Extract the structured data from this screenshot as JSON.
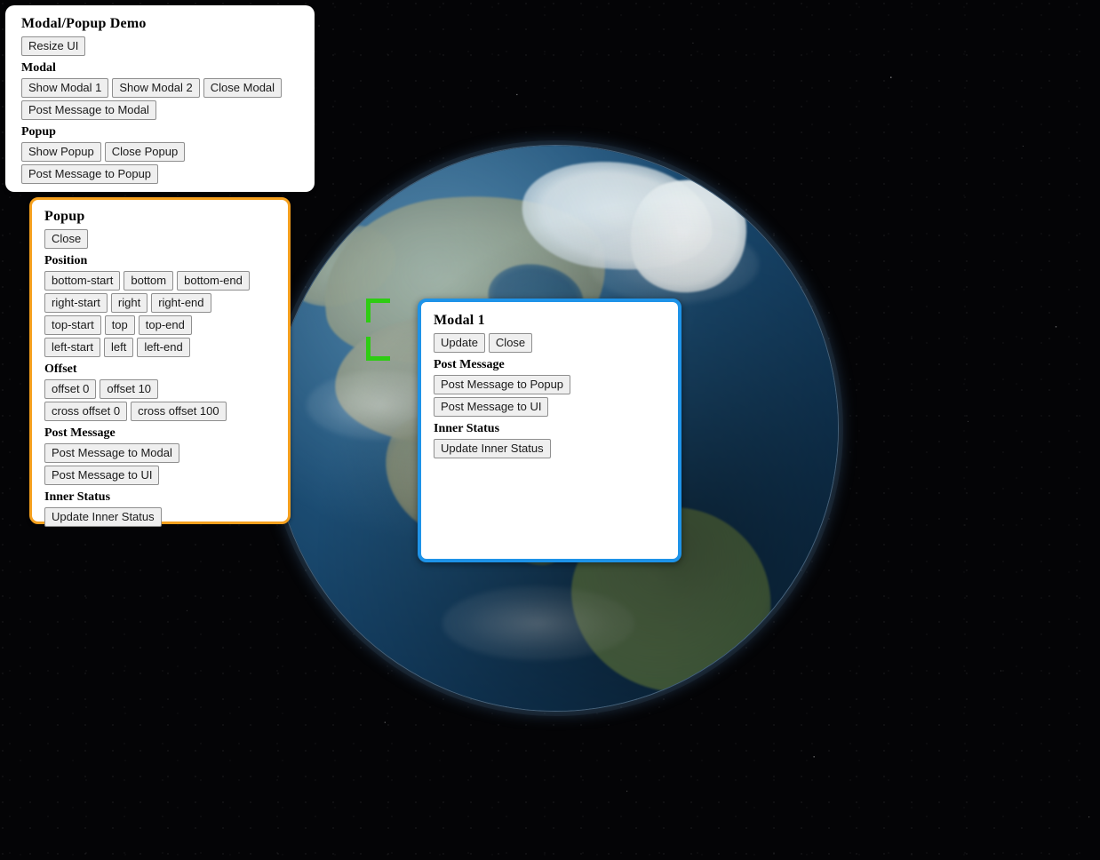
{
  "scene": {
    "background": "starfield-space",
    "globe": {
      "name": "earth-globe",
      "visible_region": "North America",
      "ocean_color": "#1d4f76",
      "land_color": "#8a947b",
      "ice_color": "#e8eef0"
    },
    "reticle": {
      "name": "selection-reticle",
      "color": "#2ecc13"
    }
  },
  "demo_panel": {
    "title": "Modal/Popup Demo",
    "resize_label": "Resize UI",
    "modal_section": {
      "heading": "Modal",
      "buttons": [
        "Show Modal 1",
        "Show Modal 2",
        "Close Modal",
        "Post Message to Modal"
      ]
    },
    "popup_section": {
      "heading": "Popup",
      "buttons": [
        "Show Popup",
        "Close Popup",
        "Post Message to Popup"
      ]
    }
  },
  "popup_panel": {
    "title": "Popup",
    "border_color": "#f5a01e",
    "close_label": "Close",
    "position_section": {
      "heading": "Position",
      "rows": [
        [
          "bottom-start",
          "bottom",
          "bottom-end"
        ],
        [
          "right-start",
          "right",
          "right-end"
        ],
        [
          "top-start",
          "top",
          "top-end"
        ],
        [
          "left-start",
          "left",
          "left-end"
        ]
      ]
    },
    "offset_section": {
      "heading": "Offset",
      "rows": [
        [
          "offset 0",
          "offset 10"
        ],
        [
          "cross offset 0",
          "cross offset 100"
        ]
      ]
    },
    "post_message_section": {
      "heading": "Post Message",
      "buttons": [
        "Post Message to Modal",
        "Post Message to UI"
      ]
    },
    "inner_status_section": {
      "heading": "Inner Status",
      "button": "Update Inner Status"
    }
  },
  "modal_panel": {
    "title": "Modal 1",
    "border_color": "#1e93e8",
    "update_label": "Update",
    "close_label": "Close",
    "post_message_section": {
      "heading": "Post Message",
      "buttons": [
        "Post Message to Popup",
        "Post Message to UI"
      ]
    },
    "inner_status_section": {
      "heading": "Inner Status",
      "button": "Update Inner Status"
    }
  }
}
